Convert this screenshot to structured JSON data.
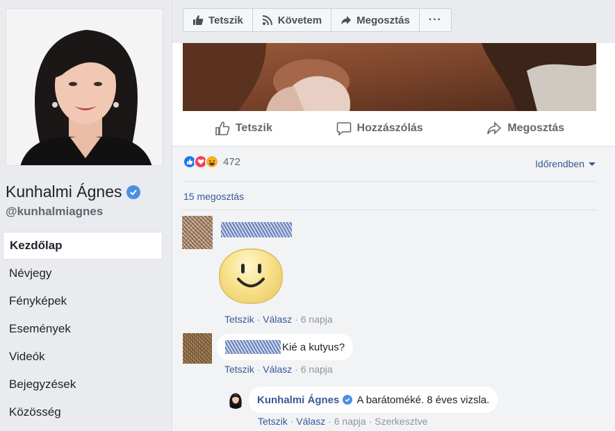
{
  "page": {
    "name": "Kunhalmi Ágnes",
    "handle": "@kunhalmiagnes"
  },
  "nav": {
    "items": [
      {
        "label": "Kezdőlap",
        "active": true
      },
      {
        "label": "Névjegy"
      },
      {
        "label": "Fényképek"
      },
      {
        "label": "Események"
      },
      {
        "label": "Videók"
      },
      {
        "label": "Bejegyzések"
      },
      {
        "label": "Közösség"
      }
    ]
  },
  "page_actions": {
    "like": "Tetszik",
    "follow": "Követem",
    "share": "Megosztás",
    "more": "···"
  },
  "post_actions": {
    "like": "Tetszik",
    "comment": "Hozzászólás",
    "share": "Megosztás"
  },
  "reactions": {
    "count": "472",
    "icons": [
      "like-icon",
      "love-icon",
      "haha-icon"
    ],
    "colors": {
      "like": "#1877f2",
      "love": "#f33e58",
      "haha": "#f7b125"
    }
  },
  "sort": {
    "label": "Időrendben"
  },
  "shares": {
    "label": "15 megosztás"
  },
  "comments": [
    {
      "sticker": "smiley-sticker",
      "actions": {
        "like": "Tetszik",
        "reply": "Válasz",
        "time": "6 napja"
      }
    },
    {
      "text": "Kié a kutyus?",
      "actions": {
        "like": "Tetszik",
        "reply": "Válasz",
        "time": "6 napja"
      }
    },
    {
      "author": "Kunhalmi Ágnes",
      "text": "A barátoméké. 8 éves vizsla.",
      "actions": {
        "like": "Tetszik",
        "reply": "Válasz",
        "time": "6 napja",
        "edited": "Szerkesztve"
      }
    }
  ],
  "separator": "·",
  "theme": {
    "link": "#385898",
    "verified": "#4a90e2",
    "bg": "#e9ebee"
  }
}
